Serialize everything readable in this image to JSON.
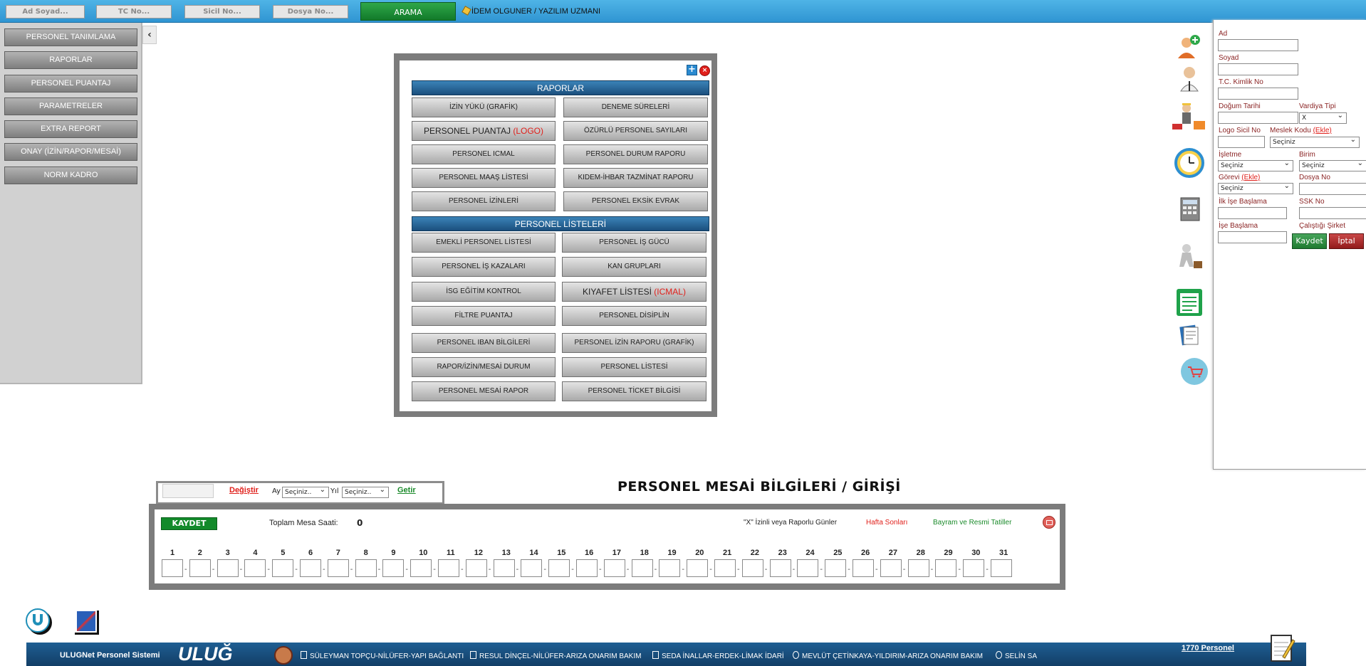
{
  "topbar": {
    "fields": [
      "Ad Soyad...",
      "TC No...",
      "Sicil No...",
      "Dosya No..."
    ],
    "search_label": "ARAMA",
    "user": "İDEM OLGUNER / YAZILIM UZMANI"
  },
  "sidebar": {
    "items": [
      "PERSONEL TANIMLAMA",
      "RAPORLAR",
      "PERSONEL PUANTAJ",
      "PARAMETRELER",
      "EXTRA REPORT",
      "ONAY (İZİN/RAPOR/MESAİ)",
      "NORM KADRO"
    ]
  },
  "reports": {
    "header": "RAPORLAR",
    "plus_icon": "+",
    "close_icon": "×",
    "row1": [
      {
        "left": "İZİN YÜKÜ (GRAFİK)",
        "right": "DENEME SÜRELERİ"
      },
      {
        "left": "PERSONEL PUANTAJ",
        "left_suffix": "(LOGO)",
        "right": "ÖZÜRLÜ PERSONEL SAYILARI"
      },
      {
        "left": "PERSONEL ICMAL",
        "right": "PERSONEL DURUM RAPORU"
      },
      {
        "left": "PERSONEL MAAŞ LİSTESİ",
        "right": "KIDEM-İHBAR TAZMİNAT RAPORU"
      },
      {
        "left": "PERSONEL İZİNLERİ",
        "right": "PERSONEL EKSİK EVRAK"
      }
    ],
    "lists_header": "PERSONEL LİSTELERİ",
    "row2": [
      {
        "left": "EMEKLİ PERSONEL LİSTESİ",
        "right": "PERSONEL İŞ GÜCÜ"
      },
      {
        "left": "PERSONEL İŞ KAZALARI",
        "right": "KAN GRUPLARI"
      },
      {
        "left": "İSG EĞİTİM KONTROL",
        "right": "KIYAFET LİSTESİ",
        "right_suffix": "(ICMAL)"
      },
      {
        "left": "FİLTRE PUANTAJ",
        "right": "PERSONEL DİSİPLİN"
      },
      {
        "left": "PERSONEL IBAN BİLGİLERİ",
        "right": "PERSONEL İZİN RAPORU (GRAFİK)"
      },
      {
        "left": "RAPOR/İZİN/MESAİ DURUM",
        "right": "PERSONEL LİSTESİ"
      },
      {
        "left": "PERSONEL MESAİ RAPOR",
        "right": "PERSONEL TİCKET BİLGİSİ"
      }
    ]
  },
  "form": {
    "ad": "Ad",
    "soyad": "Soyad",
    "tc": "T.C. Kimlik No",
    "dogum": "Doğum Tarihi",
    "vardiya": "Vardiya Tipi",
    "vardiya_value": "X",
    "logo_sicil": "Logo Sicil No",
    "meslek": "Meslek Kodu",
    "ekle": "(Ekle)",
    "secimiz": "Seçiniz",
    "isletme": "İşletme",
    "birim": "Birim",
    "gorevi": "Görevi",
    "dosya": "Dosya No",
    "ilk_ise": "İlk İşe Başlama",
    "ssk": "SSK No",
    "ise_baslama": "İşe Başlama",
    "calistigi": "Çalıştığı Şirket",
    "save": "Kaydet",
    "cancel": "İptal"
  },
  "mesai": {
    "title": "PERSONEL MESAİ BİLGİLERİ / GİRİŞİ",
    "degistir": "Değiştir",
    "ay_label": "Ay",
    "ay_value": "Seçiniz..",
    "yil_label": "Yıl",
    "yil_value": "Seçiniz..",
    "getir": "Getir",
    "kaydet": "KAYDET",
    "toplam_label": "Toplam Mesa Saati:",
    "toplam_value": "0",
    "legend_x": "\"X\" İzinli veya Raporlu Günler",
    "legend_weekend": "Hafta Sonları",
    "legend_holiday": "Bayram ve Resmi Tatiller",
    "days": [
      "1",
      "2",
      "3",
      "4",
      "5",
      "6",
      "7",
      "8",
      "9",
      "10",
      "11",
      "12",
      "13",
      "14",
      "15",
      "16",
      "17",
      "18",
      "19",
      "20",
      "21",
      "22",
      "23",
      "24",
      "25",
      "26",
      "27",
      "28",
      "29",
      "30",
      "31"
    ]
  },
  "footer": {
    "app_name": "ULUGNet Personel Sistemi",
    "brand": "ULUĞ",
    "personel_count": "1770 Personel",
    "ticker": [
      "SÜLEYMAN TOPÇU-NİLÜFER-YAPI BAĞLANTI",
      "RESUL DİNÇEL-NİLÜFER-ARIZA ONARIM BAKIM",
      "SEDA İNALLAR-ERDEK-LİMAK İDARİ",
      "MEVLÜT ÇETİNKAYA-YILDIRIM-ARIZA ONARIM BAKIM",
      "SELİN SA"
    ]
  },
  "colors": {
    "topbar": "#2f95d2",
    "search": "#127a2a",
    "menu": "#7e7e7e",
    "report_header": "#1b4f7d",
    "accent_red": "#e0201b",
    "getir_green": "#1a8a2a",
    "footer": "#123e66"
  }
}
